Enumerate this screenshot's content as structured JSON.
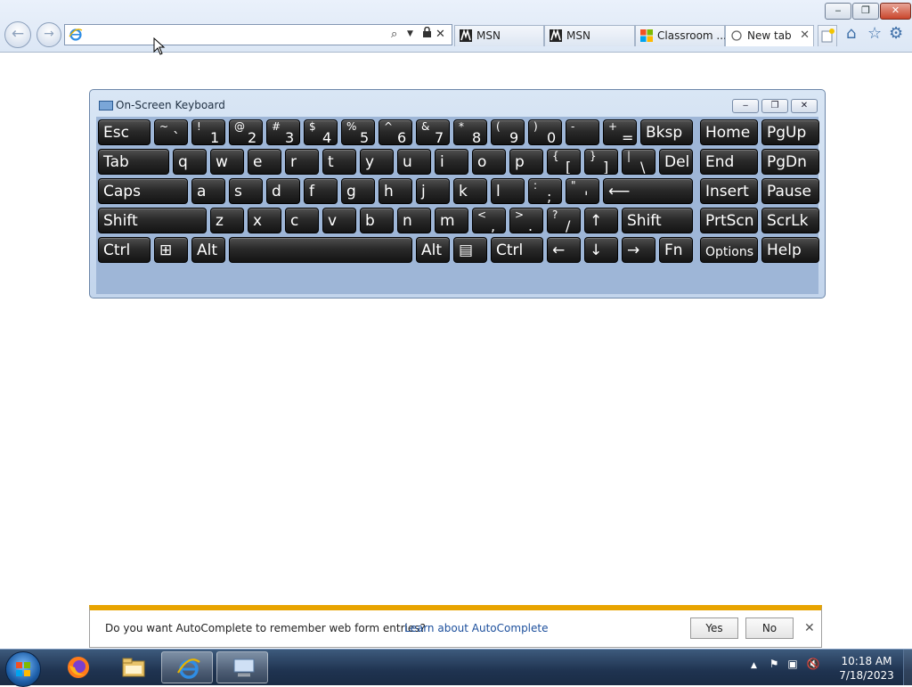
{
  "browser": {
    "window_controls": {
      "minimize": "‒",
      "maximize": "❐",
      "close": "✕"
    },
    "address_bar": {
      "value": "",
      "placeholder": ""
    },
    "tabs": [
      {
        "label": "MSN",
        "icon": "msn-icon"
      },
      {
        "label": "MSN",
        "icon": "msn-icon"
      },
      {
        "label": "Classroom ...",
        "icon": "microsoft-icon"
      },
      {
        "label": "New tab",
        "icon": "loading-icon"
      }
    ],
    "toolbar_icons": [
      "home-icon",
      "favorites-star-icon",
      "tools-gear-icon"
    ]
  },
  "osk": {
    "title": "On-Screen Keyboard",
    "rows": [
      [
        {
          "label": "Esc"
        },
        {
          "shift": "~",
          "base": "`"
        },
        {
          "shift": "!",
          "base": "1"
        },
        {
          "shift": "@",
          "base": "2"
        },
        {
          "shift": "#",
          "base": "3"
        },
        {
          "shift": "$",
          "base": "4"
        },
        {
          "shift": "%",
          "base": "5"
        },
        {
          "shift": "^",
          "base": "6"
        },
        {
          "shift": "&",
          "base": "7"
        },
        {
          "shift": "*",
          "base": "8"
        },
        {
          "shift": "(",
          "base": "9"
        },
        {
          "shift": ")",
          "base": "0"
        },
        {
          "shift": "-",
          "base": "_"
        },
        {
          "shift": "+",
          "base": "="
        },
        {
          "label": "Bksp"
        },
        {
          "label": "Home"
        },
        {
          "label": "PgUp"
        }
      ],
      [
        {
          "label": "Tab"
        },
        {
          "label": "q"
        },
        {
          "label": "w"
        },
        {
          "label": "e"
        },
        {
          "label": "r"
        },
        {
          "label": "t"
        },
        {
          "label": "y"
        },
        {
          "label": "u"
        },
        {
          "label": "i"
        },
        {
          "label": "o"
        },
        {
          "label": "p"
        },
        {
          "shift": "{",
          "base": "["
        },
        {
          "shift": "}",
          "base": "]"
        },
        {
          "shift": "|",
          "base": "\\"
        },
        {
          "label": "Del"
        },
        {
          "label": "End"
        },
        {
          "label": "PgDn"
        }
      ],
      [
        {
          "label": "Caps"
        },
        {
          "label": "a"
        },
        {
          "label": "s"
        },
        {
          "label": "d"
        },
        {
          "label": "f"
        },
        {
          "label": "g"
        },
        {
          "label": "h"
        },
        {
          "label": "j"
        },
        {
          "label": "k"
        },
        {
          "label": "l"
        },
        {
          "shift": ":",
          "base": ";"
        },
        {
          "shift": "\"",
          "base": "'"
        },
        {
          "label": "⟵"
        },
        {
          "label": "Insert"
        },
        {
          "label": "Pause"
        }
      ],
      [
        {
          "label": "Shift"
        },
        {
          "label": "z"
        },
        {
          "label": "x"
        },
        {
          "label": "c"
        },
        {
          "label": "v"
        },
        {
          "label": "b"
        },
        {
          "label": "n"
        },
        {
          "label": "m"
        },
        {
          "shift": "<",
          "base": ","
        },
        {
          "shift": ">",
          "base": "."
        },
        {
          "shift": "?",
          "base": "/"
        },
        {
          "label": "↑"
        },
        {
          "label": "Shift"
        },
        {
          "label": "PrtScn"
        },
        {
          "label": "ScrLk"
        }
      ],
      [
        {
          "label": "Ctrl"
        },
        {
          "label": "⊞"
        },
        {
          "label": "Alt"
        },
        {
          "label": ""
        },
        {
          "label": "Alt"
        },
        {
          "label": "▤"
        },
        {
          "label": "Ctrl"
        },
        {
          "label": "←"
        },
        {
          "label": "↓"
        },
        {
          "label": "→"
        },
        {
          "label": "Fn"
        },
        {
          "label": "Options"
        },
        {
          "label": "Help"
        }
      ]
    ]
  },
  "autocomplete_bar": {
    "message": "Do you want AutoComplete to remember web form entries?",
    "link": "Learn about AutoComplete",
    "yes": "Yes",
    "no": "No",
    "close": "✕"
  },
  "taskbar": {
    "pinned": [
      "firefox-icon",
      "file-explorer-icon",
      "internet-explorer-icon",
      "on-screen-keyboard-icon"
    ],
    "tray_chevron": "▲",
    "clock_time": "10:18 AM",
    "clock_date": "7/18/2023"
  }
}
